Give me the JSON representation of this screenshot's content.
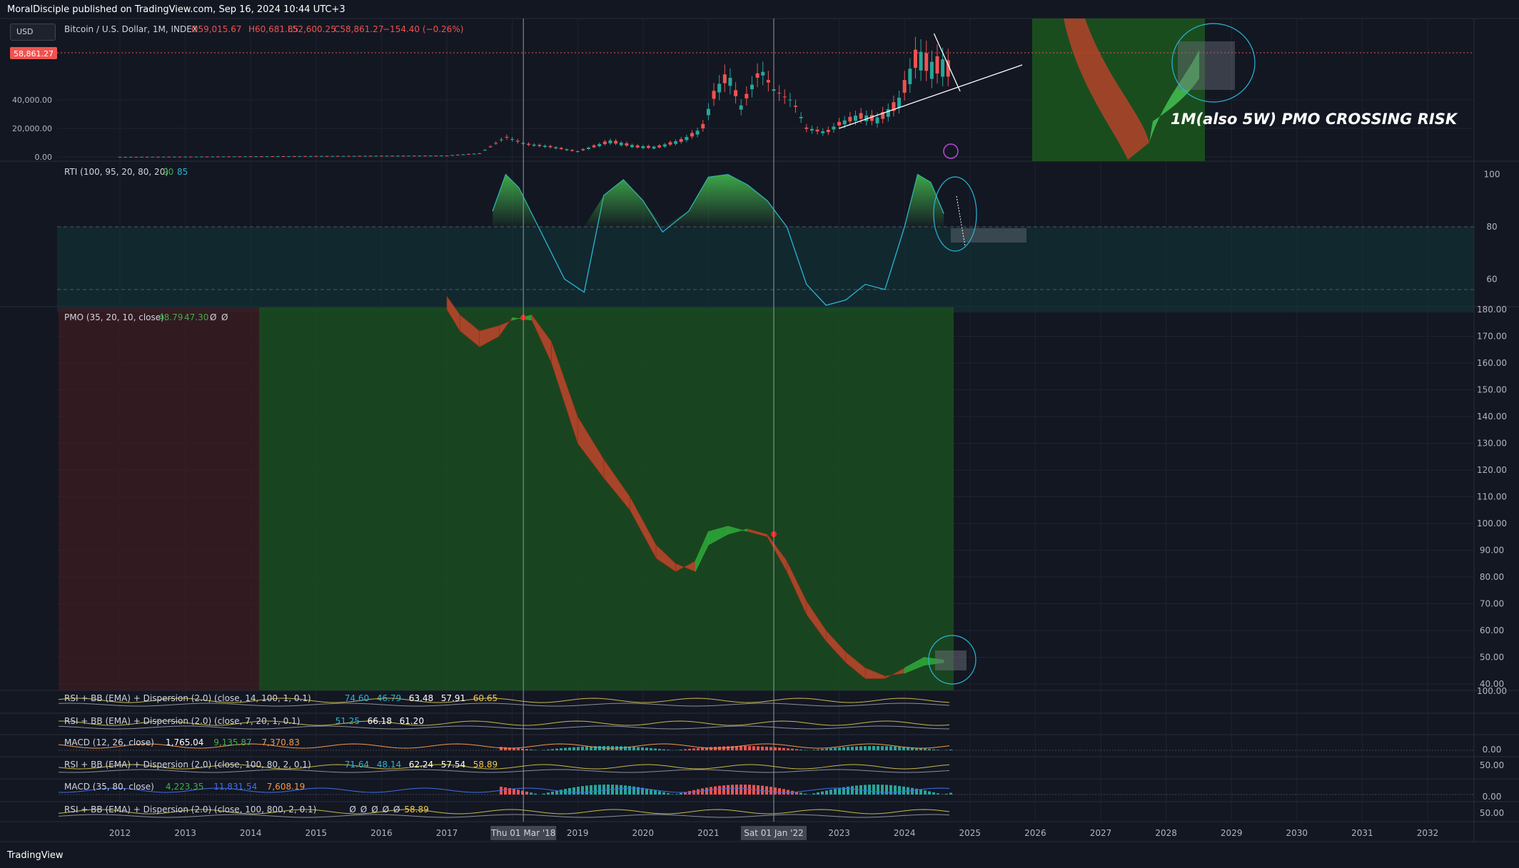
{
  "header": {
    "published": "MoralDisciple published on TradingView.com, Sep 16, 2024 10:44 UTC+3",
    "currency": "USD",
    "symbol": "Bitcoin / U.S. Dollar, 1M, INDEX",
    "ohlc": {
      "o": "O59,015.67",
      "h": "H60,681.85",
      "l": "L52,600.25",
      "c": "C58,861.27",
      "change": "−154.40 (−0.26%)"
    },
    "last_price": "58,861.27"
  },
  "annotation": "1M(also 5W) PMO CROSSING RISK",
  "logo": "TradingView",
  "colors": {
    "bg": "#131722",
    "up": "#26a69a",
    "down": "#ef5350",
    "green_zone": "#1a4d1e",
    "red_zone": "#3d1c22",
    "accent_cyan": "#29b6d6"
  },
  "chart_data": [
    {
      "type": "candlestick",
      "name": "price",
      "y_ticks": [
        "0.00",
        "20,000.00",
        "40,000.00"
      ],
      "x_ticks": [
        "2012",
        "2013",
        "2014",
        "2015",
        "2016",
        "2017",
        "2018",
        "2019",
        "2020",
        "2021",
        "2022",
        "2023",
        "2024",
        "2025",
        "2026",
        "2027",
        "2028",
        "2029",
        "2030",
        "2031",
        "2032"
      ],
      "x": [
        2017.0,
        2017.5,
        2017.9,
        2018.2,
        2018.6,
        2019.0,
        2019.5,
        2019.9,
        2020.2,
        2020.6,
        2020.9,
        2021.1,
        2021.3,
        2021.5,
        2021.8,
        2022.0,
        2022.3,
        2022.5,
        2022.8,
        2023.0,
        2023.3,
        2023.6,
        2023.9,
        2024.2,
        2024.4,
        2024.6,
        2024.7
      ],
      "close": [
        1000,
        2500,
        14000,
        9000,
        7000,
        3800,
        10800,
        7200,
        6600,
        11500,
        19000,
        45000,
        57000,
        35000,
        61000,
        47000,
        38500,
        20000,
        17000,
        23000,
        28500,
        26000,
        37000,
        71000,
        62000,
        64000,
        58861
      ]
    },
    {
      "type": "line",
      "name": "RTI",
      "title": "RTI (100, 95, 20, 80, 20)",
      "values_label": [
        "90",
        "85"
      ],
      "y_ticks": [
        "100",
        "80",
        "60"
      ],
      "x": [
        2017.7,
        2017.9,
        2018.1,
        2018.4,
        2018.8,
        2019.1,
        2019.4,
        2019.7,
        2020.0,
        2020.3,
        2020.7,
        2021.0,
        2021.3,
        2021.6,
        2021.9,
        2022.2,
        2022.5,
        2022.8,
        2023.1,
        2023.4,
        2023.7,
        2024.0,
        2024.2,
        2024.4,
        2024.6
      ],
      "y": [
        86,
        100,
        95,
        80,
        60,
        55,
        92,
        98,
        90,
        78,
        86,
        99,
        100,
        96,
        90,
        80,
        58,
        50,
        52,
        58,
        56,
        80,
        100,
        97,
        85
      ]
    },
    {
      "type": "area",
      "name": "PMO",
      "title": "PMO (35, 20, 10, close)",
      "values_label": [
        "48.79",
        "47.30",
        "Ø",
        "Ø"
      ],
      "y_ticks": [
        "180.00",
        "170.00",
        "160.00",
        "150.00",
        "140.00",
        "130.00",
        "120.00",
        "110.00",
        "100.00",
        "90.00",
        "80.00",
        "70.00",
        "60.00",
        "50.00",
        "40.00"
      ],
      "x": [
        2017.0,
        2017.2,
        2017.5,
        2017.8,
        2018.0,
        2018.3,
        2018.6,
        2019.0,
        2019.4,
        2019.8,
        2020.2,
        2020.5,
        2020.8,
        2021.0,
        2021.3,
        2021.6,
        2021.9,
        2022.2,
        2022.5,
        2022.8,
        2023.1,
        2023.4,
        2023.7,
        2024.0,
        2024.3,
        2024.6
      ],
      "pmo": [
        180,
        172,
        166,
        170,
        177,
        176,
        160,
        130,
        117,
        105,
        87,
        82,
        86,
        97,
        99,
        97,
        95,
        82,
        66,
        56,
        48,
        42,
        42,
        46,
        50,
        49
      ],
      "signal": [
        185,
        178,
        172,
        174,
        176,
        178,
        168,
        140,
        124,
        110,
        92,
        85,
        82,
        92,
        96,
        98,
        96,
        86,
        71,
        60,
        52,
        46,
        43,
        44,
        47,
        48
      ]
    },
    {
      "type": "line",
      "name": "indicators",
      "rows": [
        {
          "title": "RSI + BB (EMA) + Dispersion (2.0) (close, 14, 100, 1, 0.1)",
          "values": [
            "74.60",
            "46.79",
            "63.48",
            "57.91",
            "60.65"
          ]
        },
        {
          "title": "RSI + BB (EMA) + Dispersion (2.0) (close, 7, 20, 1, 0.1)",
          "values": [
            "51.25",
            "66.18",
            "61.20"
          ]
        },
        {
          "title": "MACD (12, 26, close)",
          "values": [
            "1,765.04",
            "9,135.87",
            "7,370.83"
          ]
        },
        {
          "title": "RSI + BB (EMA) + Dispersion (2.0) (close, 100, 80, 2, 0.1)",
          "values": [
            "71.64",
            "48.14",
            "62.24",
            "57.54",
            "58.89"
          ]
        },
        {
          "title": "MACD (35, 80, close)",
          "values": [
            "4,223.35",
            "11,831.54",
            "7,608.19"
          ]
        },
        {
          "title": "RSI + BB (EMA) + Dispersion (2.0) (close, 100, 800, 2, 0.1)",
          "values": [
            "Ø",
            "Ø",
            "Ø",
            "Ø",
            "Ø",
            "58.89"
          ]
        }
      ],
      "right_ticks": [
        "100.00",
        "0.00",
        "50.00",
        "0.00",
        "50.00"
      ]
    }
  ],
  "crosshair_labels": [
    "Thu 01 Mar '18",
    "Sat 01 Jan '22"
  ]
}
